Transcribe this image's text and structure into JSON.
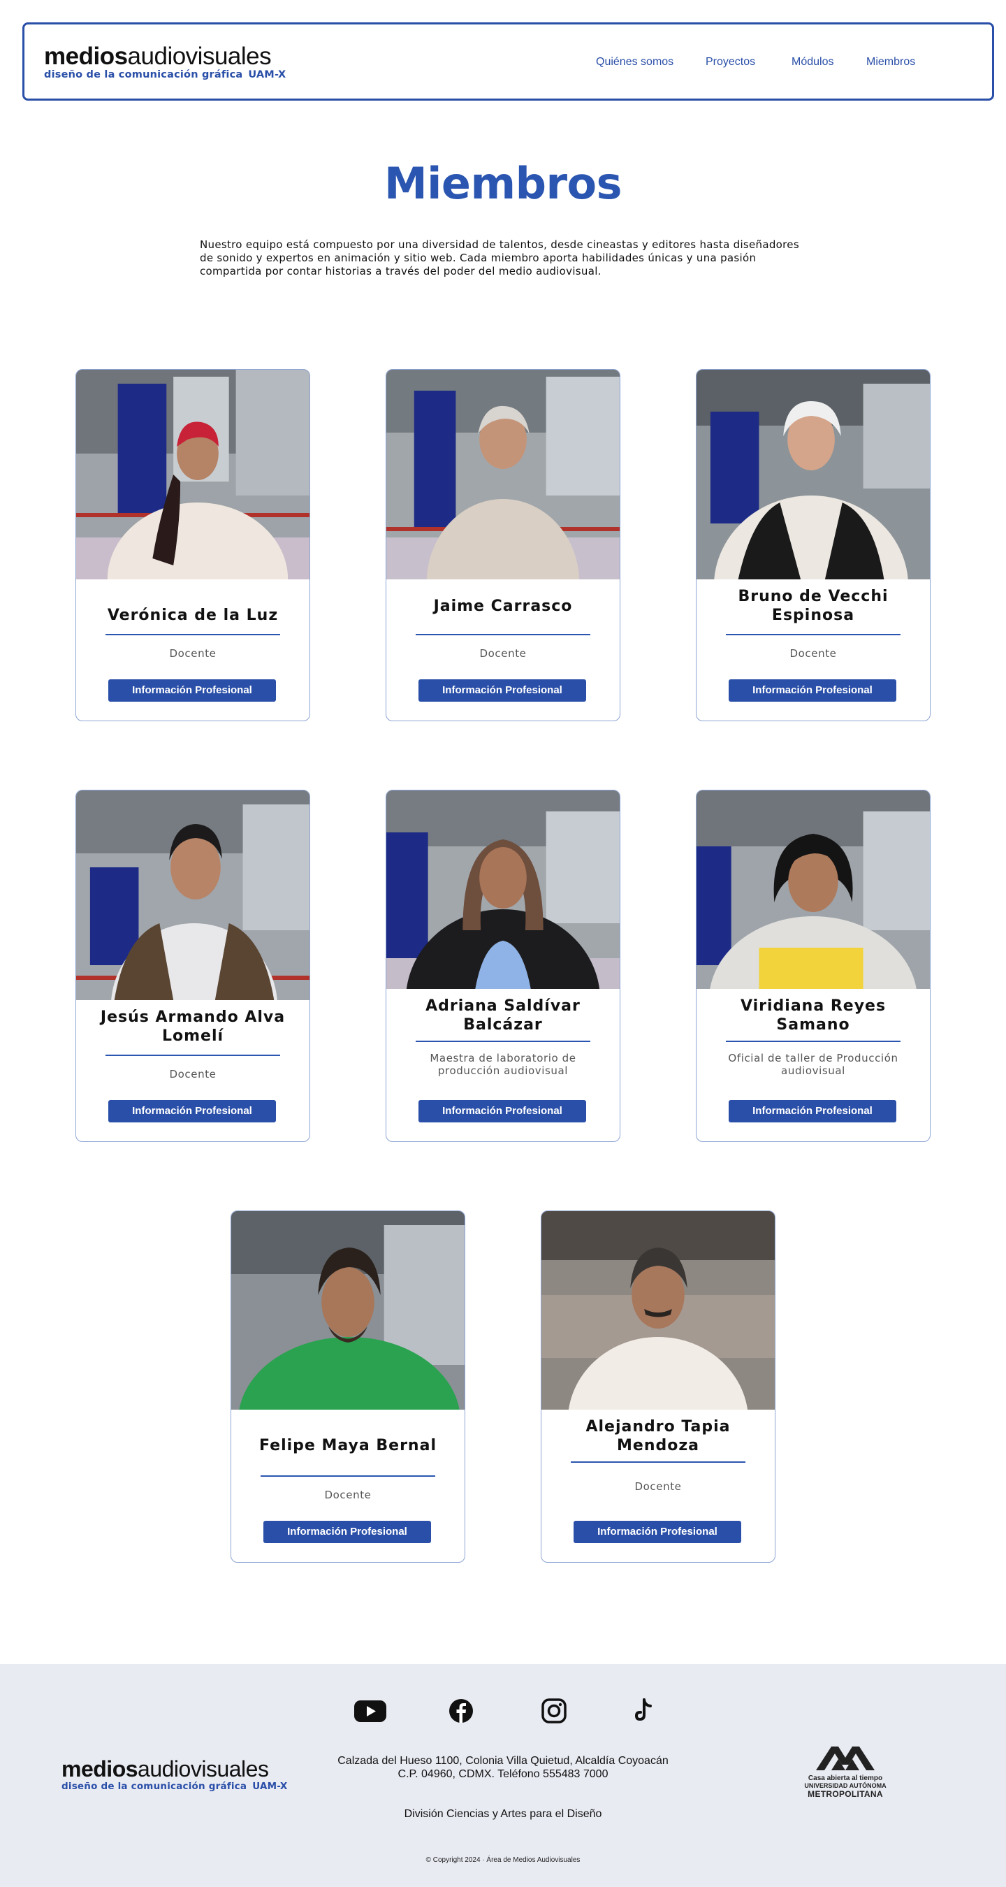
{
  "brand": {
    "name_bold": "medios",
    "name_light": "audiovisuales",
    "tagline": "diseño de la comunicación gráfica",
    "tagline_suffix": "UAM-X",
    "accent_color": "#2a4fa8"
  },
  "nav": {
    "items": [
      {
        "label": "Quiénes somos"
      },
      {
        "label": "Proyectos"
      },
      {
        "label": "Módulos"
      },
      {
        "label": "Miembros"
      }
    ]
  },
  "page": {
    "title": "Miembros",
    "intro": "Nuestro equipo está compuesto por una diversidad de talentos, desde cineastas y editores hasta diseñadores de sonido y expertos en animación y sitio web. Cada miembro aporta habilidades únicas y una pasión compartida por contar historias a través del poder del medio audiovisual."
  },
  "members": [
    {
      "name": "Verónica de la Luz",
      "role": "Docente",
      "button": "Información Profesional"
    },
    {
      "name": "Jaime Carrasco",
      "role": "Docente",
      "button": "Información Profesional"
    },
    {
      "name": "Bruno de Vecchi Espinosa",
      "role": "Docente",
      "button": "Información Profesional"
    },
    {
      "name": "Jesús Armando Alva Lomelí",
      "role": "Docente",
      "button": "Información Profesional"
    },
    {
      "name": "Adriana Saldívar Balcázar",
      "role": "Maestra de laboratorio de producción audiovisual",
      "button": "Información Profesional"
    },
    {
      "name": "Viridiana Reyes Samano",
      "role": "Oficial de taller de Producción audiovisual",
      "button": "Información Profesional"
    },
    {
      "name": "Felipe Maya Bernal",
      "role": "Docente",
      "button": "Información Profesional"
    },
    {
      "name": "Alejandro Tapia Mendoza",
      "role": "Docente",
      "button": "Información Profesional"
    }
  ],
  "footer": {
    "social": [
      "youtube-icon",
      "facebook-icon",
      "instagram-icon",
      "tiktok-icon"
    ],
    "address_line1": "Calzada del Hueso 1100, Colonia Villa Quietud, Alcaldía Coyoacán",
    "address_line2": "C.P. 04960, CDMX. Teléfono 555483 7000",
    "division": "División Ciencias y Artes para el Diseño",
    "copyright": "© Copyright 2024 · Área de Medios Audiovisuales",
    "uam_line1": "Casa abierta al tiempo",
    "uam_line2": "UNIVERSIDAD AUTÓNOMA",
    "uam_line3": "METROPOLITANA"
  }
}
